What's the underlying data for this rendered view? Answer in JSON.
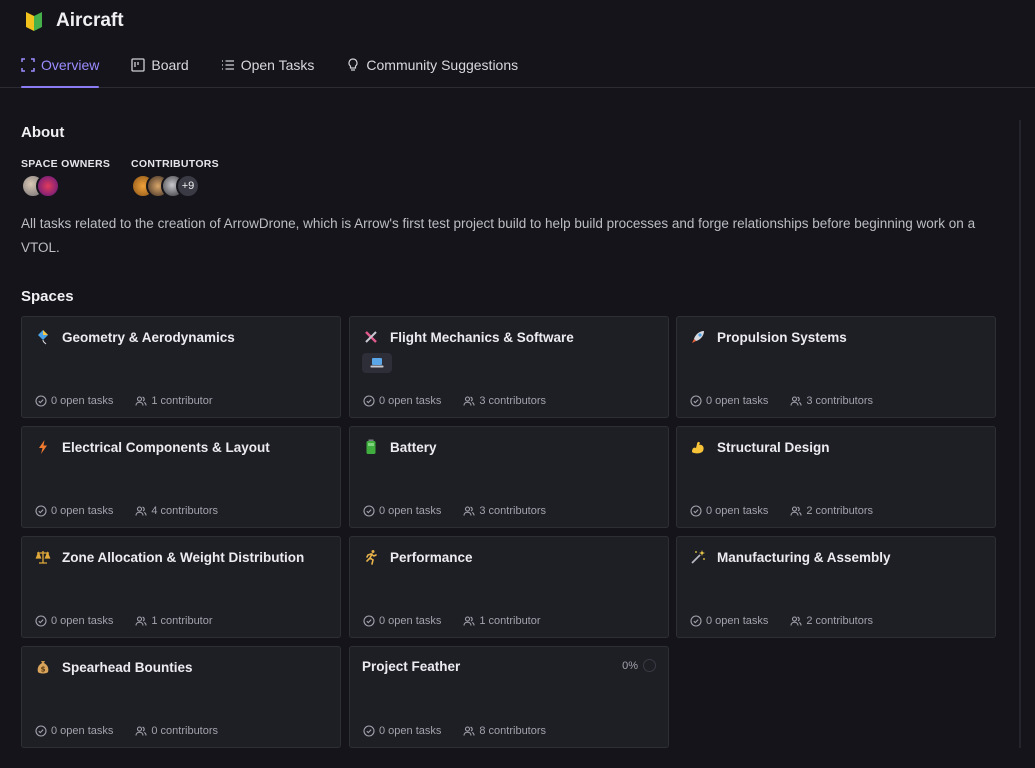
{
  "header": {
    "title": "Aircraft",
    "tabs": [
      {
        "label": "Overview"
      },
      {
        "label": "Board"
      },
      {
        "label": "Open Tasks"
      },
      {
        "label": "Community Suggestions"
      }
    ]
  },
  "about": {
    "heading": "About",
    "owners_label": "SPACE OWNERS",
    "contributors_label": "CONTRIBUTORS",
    "contributors_more": "+9",
    "description": "All tasks related to the creation of ArrowDrone, which is Arrow's first test project build to help build processes and forge relationships before beginning work on a VTOL."
  },
  "spaces": {
    "heading": "Spaces",
    "cards": [
      {
        "name": "Geometry & Aerodynamics",
        "icon": "kite-icon",
        "open_tasks": "0 open tasks",
        "contributors": "1 contributor"
      },
      {
        "name": "Flight Mechanics & Software",
        "icon": "crossed-tools-icon",
        "open_tasks": "0 open tasks",
        "contributors": "3 contributors"
      },
      {
        "name": "Propulsion Systems",
        "icon": "rocket-icon",
        "open_tasks": "0 open tasks",
        "contributors": "3 contributors"
      },
      {
        "name": "Electrical Components & Layout",
        "icon": "lightning-icon",
        "open_tasks": "0 open tasks",
        "contributors": "4 contributors"
      },
      {
        "name": "Battery",
        "icon": "battery-icon",
        "open_tasks": "0 open tasks",
        "contributors": "3 contributors"
      },
      {
        "name": "Structural Design",
        "icon": "flexed-arm-icon",
        "open_tasks": "0 open tasks",
        "contributors": "2 contributors"
      },
      {
        "name": "Zone Allocation & Weight Distribution",
        "icon": "scales-icon",
        "open_tasks": "0 open tasks",
        "contributors": "1 contributor"
      },
      {
        "name": "Performance",
        "icon": "runner-icon",
        "open_tasks": "0 open tasks",
        "contributors": "1 contributor"
      },
      {
        "name": "Manufacturing & Assembly",
        "icon": "magic-wand-icon",
        "open_tasks": "0 open tasks",
        "contributors": "2 contributors"
      },
      {
        "name": "Spearhead Bounties",
        "icon": "money-bag-icon",
        "open_tasks": "0 open tasks",
        "contributors": "0 contributors"
      },
      {
        "name": "Project Feather",
        "icon": "",
        "open_tasks": "0 open tasks",
        "contributors": "8 contributors",
        "progress": "0%"
      }
    ]
  },
  "colors": {
    "background": "#14141a",
    "card": "#1e1e25",
    "accent": "#8b7bf5"
  }
}
